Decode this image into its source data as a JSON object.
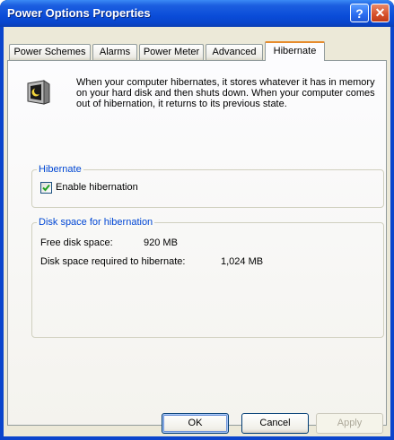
{
  "window": {
    "title": "Power Options Properties",
    "help_glyph": "?",
    "close_glyph": "✕"
  },
  "tabs": [
    {
      "label": "Power Schemes"
    },
    {
      "label": "Alarms"
    },
    {
      "label": "Power Meter"
    },
    {
      "label": "Advanced"
    },
    {
      "label": "Hibernate",
      "active": true
    }
  ],
  "intro": {
    "text": "When your computer hibernates, it stores whatever it has in memory on your hard disk and then shuts down. When your computer comes out of hibernation, it returns to its previous state."
  },
  "hibernate_group": {
    "legend": "Hibernate",
    "checkbox_label": "Enable hibernation",
    "checked": true
  },
  "disk_group": {
    "legend": "Disk space for hibernation",
    "free_label": "Free disk space:",
    "free_value": "920 MB",
    "required_label": "Disk space required to hibernate:",
    "required_value": "1,024 MB"
  },
  "buttons": {
    "ok": "OK",
    "cancel": "Cancel",
    "apply": "Apply"
  },
  "colors": {
    "title_bar": "#0a4cd8",
    "accent_tab": "#e68b2c",
    "group_legend": "#0046d5"
  },
  "icons": {
    "hibernate": "hibernate-monitor-icon",
    "help": "help-icon",
    "close": "close-icon",
    "check": "checkmark-icon"
  }
}
